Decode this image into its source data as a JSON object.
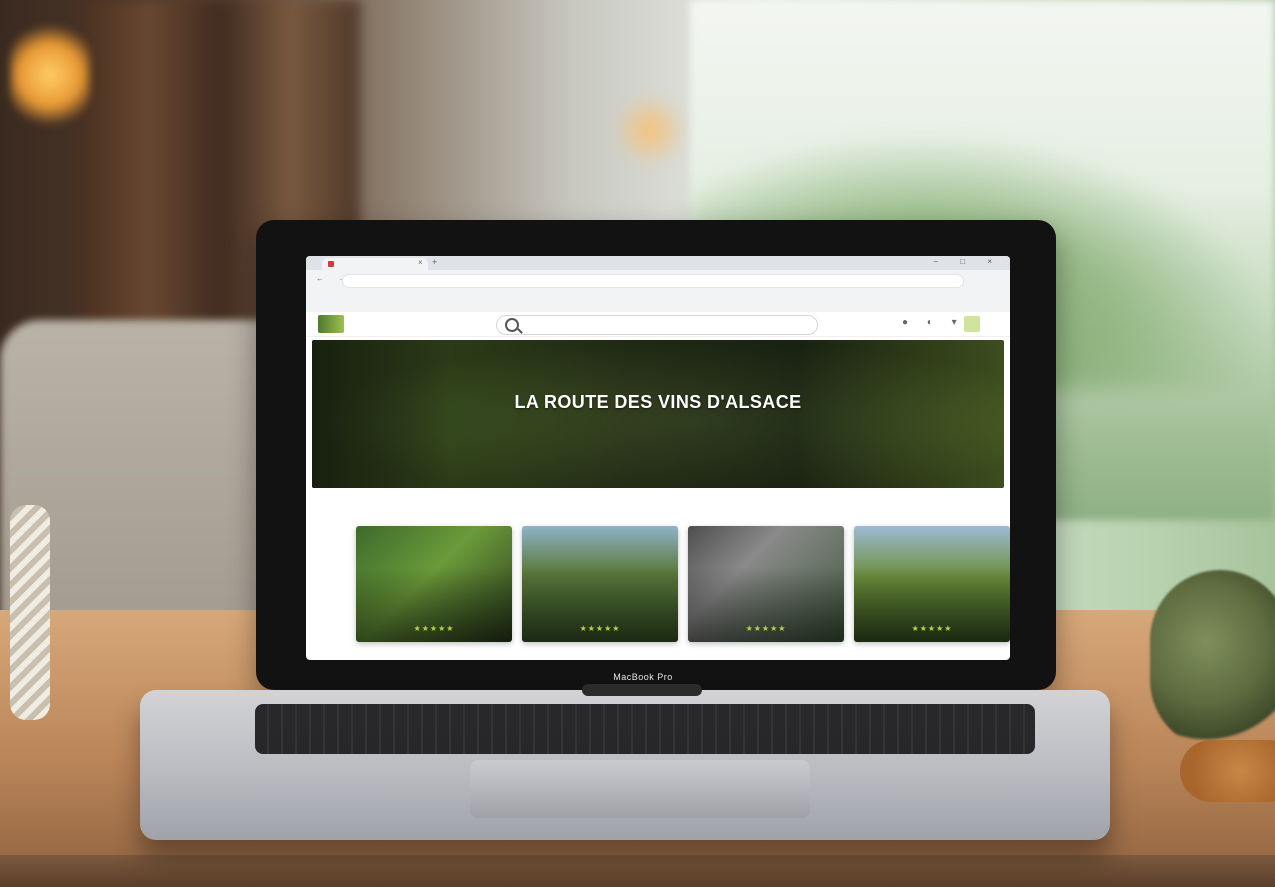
{
  "scene": {
    "laptop_brand_text": "MacBook Pro",
    "colors": {
      "accent_gold": "#d49a2f",
      "accent_green": "#8aa24d",
      "star_green": "#b8d24e"
    }
  },
  "browser": {
    "tab_title": "",
    "address": "",
    "bookmarks": []
  },
  "site": {
    "search_placeholder": "",
    "hero": {
      "title": "LA ROUTE DES VINS D'ALSACE",
      "subtitle": ""
    },
    "section": {
      "title": "",
      "link": ""
    },
    "cards": [
      {
        "name": "",
        "stars": "★★★★★"
      },
      {
        "name": "",
        "stars": "★★★★★"
      },
      {
        "name": "",
        "stars": "★★★★★"
      },
      {
        "name": "",
        "stars": "★★★★★"
      }
    ]
  }
}
